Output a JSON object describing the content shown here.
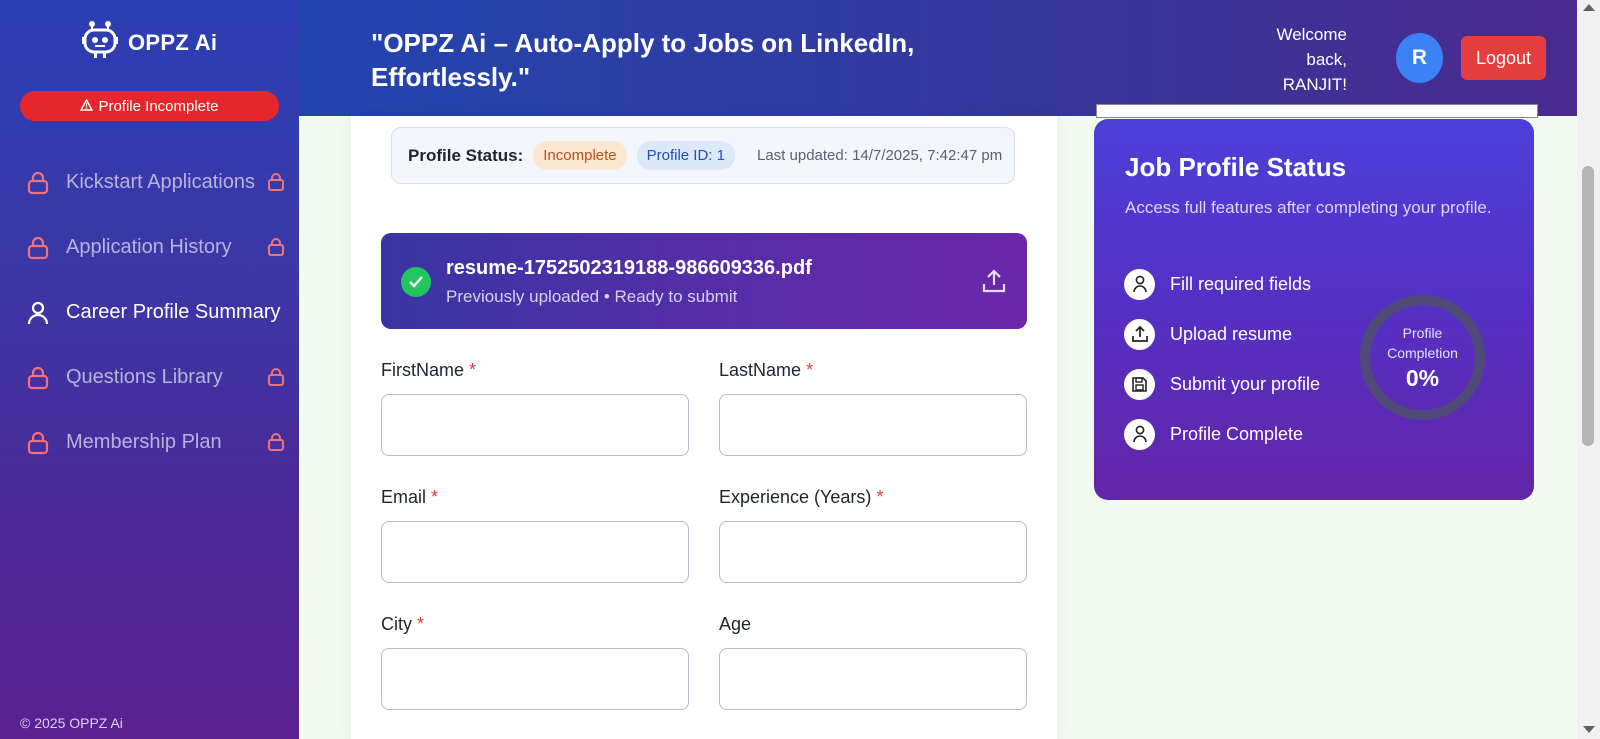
{
  "app": {
    "name": "OPPZ Ai",
    "profile_warning": "Profile Incomplete",
    "copyright": "© 2025 OPPZ Ai"
  },
  "sidebar": {
    "items": [
      {
        "label": "Kickstart Applications",
        "locked": true,
        "active": false
      },
      {
        "label": "Application History",
        "locked": true,
        "active": false
      },
      {
        "label": "Career Profile Summary",
        "locked": false,
        "active": true
      },
      {
        "label": "Questions Library",
        "locked": true,
        "active": false
      },
      {
        "label": "Membership Plan",
        "locked": true,
        "active": false
      }
    ]
  },
  "header": {
    "tagline": "\"OPPZ Ai – Auto-Apply to Jobs on LinkedIn, Effortlessly.\"",
    "welcome": "Welcome back, RANJIT!",
    "avatar_initial": "R",
    "logout_label": "Logout"
  },
  "profile_status": {
    "label": "Profile Status:",
    "status": "Incomplete",
    "profile_id": "Profile ID: 1",
    "last_updated": "Last updated: 14/7/2025, 7:42:47 pm"
  },
  "resume": {
    "filename": "resume-1752502319188-986609336.pdf",
    "subtitle": "Previously uploaded • Ready to submit"
  },
  "form": {
    "fields": [
      {
        "label": "FirstName",
        "required": "*",
        "value": ""
      },
      {
        "label": "LastName",
        "required": "*",
        "value": ""
      },
      {
        "label": "Email",
        "required": "*",
        "value": ""
      },
      {
        "label": "Experience (Years)",
        "required": "*",
        "value": ""
      },
      {
        "label": "City",
        "required": "*",
        "value": ""
      },
      {
        "label": "Age",
        "required": "",
        "value": ""
      }
    ]
  },
  "job_status": {
    "title": "Job Profile Status",
    "subtitle": "Access full features after completing your profile.",
    "steps": [
      {
        "label": "Fill required fields",
        "icon": "user-icon"
      },
      {
        "label": "Upload resume",
        "icon": "upload-icon"
      },
      {
        "label": "Submit your profile",
        "icon": "save-icon"
      },
      {
        "label": "Profile Complete",
        "icon": "user-icon"
      }
    ],
    "completion_label": "Profile Completion",
    "completion_value": "0%",
    "completion_fraction": 0
  },
  "colors": {
    "accent_red": "#e53e3e",
    "success_green": "#22c55e",
    "avatar_blue": "#3b82f6"
  }
}
